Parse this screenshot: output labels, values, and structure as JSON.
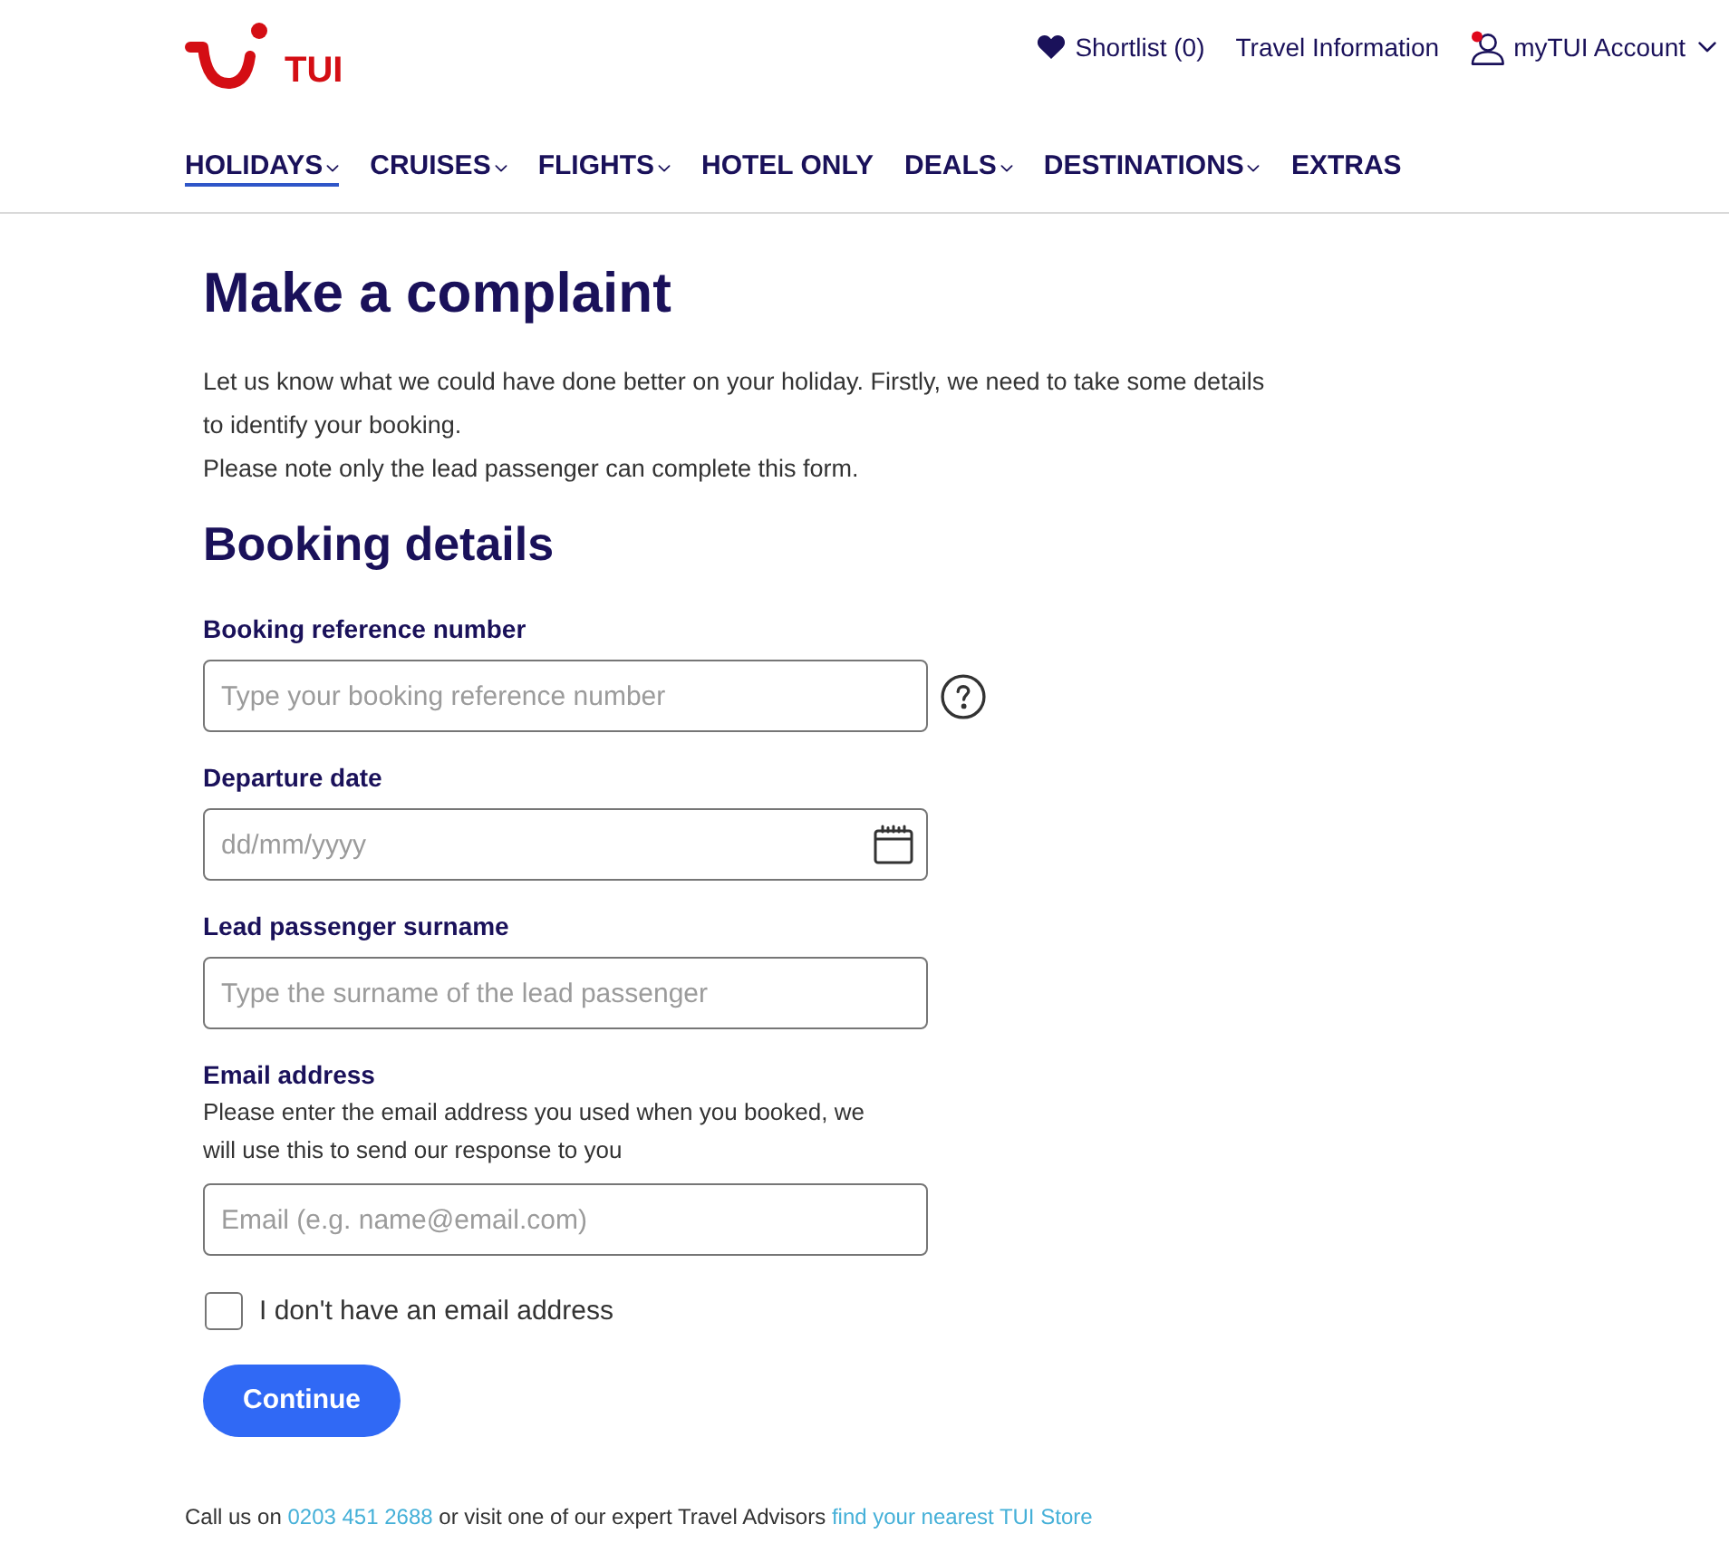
{
  "header": {
    "logo": {
      "text": "TUI"
    },
    "utility_links": [
      {
        "kind": "shortlist",
        "label": "Shortlist (0)",
        "has_menu": false
      },
      {
        "kind": "plain",
        "label": "Travel Information",
        "has_menu": false
      },
      {
        "kind": "account",
        "label": "myTUI Account",
        "has_menu": true
      }
    ]
  },
  "nav": {
    "items": [
      {
        "label": "HOLIDAYS",
        "selected": true,
        "has_menu": true
      },
      {
        "label": "CRUISES",
        "selected": false,
        "has_menu": true
      },
      {
        "label": "FLIGHTS",
        "selected": false,
        "has_menu": true
      },
      {
        "label": "HOTEL ONLY",
        "selected": false,
        "has_menu": false
      },
      {
        "label": "DEALS",
        "selected": false,
        "has_menu": true
      },
      {
        "label": "DESTINATIONS",
        "selected": false,
        "has_menu": true
      },
      {
        "label": "EXTRAS",
        "selected": false,
        "has_menu": false
      }
    ]
  },
  "page": {
    "title": "Make a complaint",
    "intro": [
      "Let us know what we could have done better on your holiday. Firstly, we need to take some details to identify your booking.",
      "Please note only the lead passenger can complete this form."
    ]
  },
  "form": {
    "title": "Booking details",
    "fields": [
      {
        "kind": "text",
        "label": "Booking reference number",
        "placeholder": "Type your booking reference number",
        "help": true
      },
      {
        "kind": "date",
        "label": "Departure date",
        "placeholder": "dd/mm/yyyy",
        "help": false
      },
      {
        "kind": "text",
        "label": "Lead passenger surname",
        "placeholder": "Type the surname of the lead passenger",
        "help": false
      },
      {
        "kind": "email",
        "label": "Email address",
        "hint": "Please enter the email address you used when you booked, we will use this to send our response to you",
        "placeholder": "Email (e.g. name@email.com)",
        "help": false
      }
    ],
    "checkbox": {
      "label": "I don't have an email address",
      "checked": false
    },
    "submit": "Continue"
  },
  "footer": {
    "parts": [
      {
        "kind": "text",
        "text": "Call us on"
      },
      {
        "kind": "link",
        "text": "0203 451 2688"
      },
      {
        "kind": "text",
        "text": "or visit one of our expert Travel Advisors"
      },
      {
        "kind": "link",
        "text": "find your nearest TUI Store"
      }
    ]
  }
}
